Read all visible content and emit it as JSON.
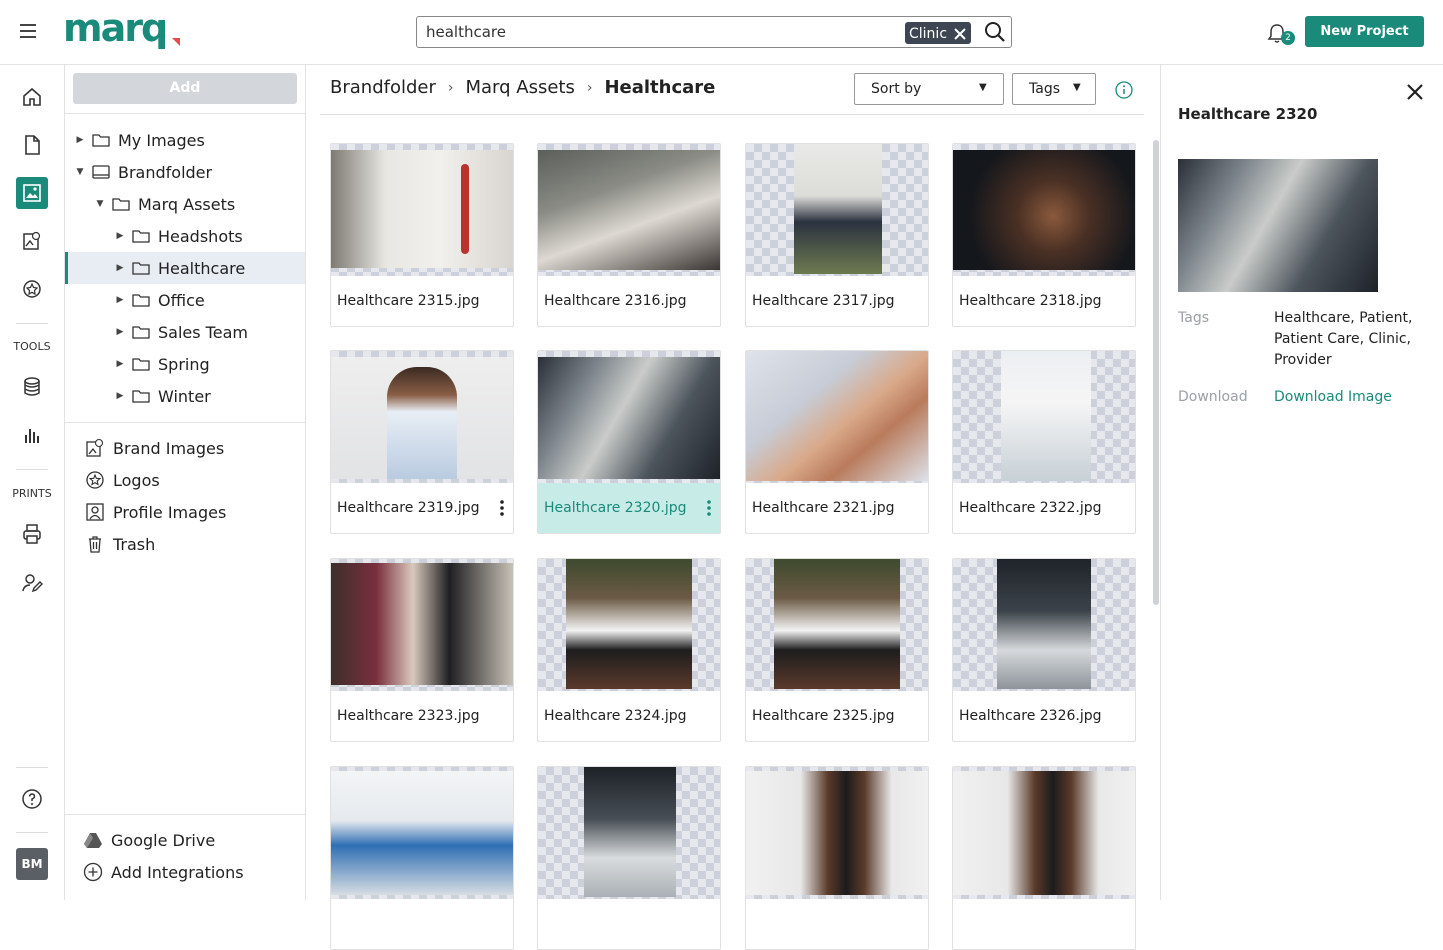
{
  "app": {
    "logo_text": "marq"
  },
  "search": {
    "query": "healthcare",
    "filter_chip": "Clinic"
  },
  "header": {
    "notification_count": "2",
    "new_project_label": "New Project"
  },
  "rail": {
    "tools_label": "TOOLS",
    "prints_label": "PRINTS",
    "avatar_initials": "BM"
  },
  "tree": {
    "add_label": "Add",
    "items": [
      {
        "label": "My Images"
      },
      {
        "label": "Brandfolder"
      },
      {
        "label": "Marq Assets"
      },
      {
        "label": "Headshots"
      },
      {
        "label": "Healthcare"
      },
      {
        "label": "Office"
      },
      {
        "label": "Sales Team"
      },
      {
        "label": "Spring"
      },
      {
        "label": "Winter"
      }
    ],
    "libraries": [
      {
        "label": "Brand Images"
      },
      {
        "label": "Logos"
      },
      {
        "label": "Profile Images"
      },
      {
        "label": "Trash"
      }
    ],
    "integrations": [
      {
        "label": "Google Drive"
      },
      {
        "label": "Add Integrations"
      }
    ]
  },
  "breadcrumb": [
    "Brandfolder",
    "Marq Assets",
    "Healthcare"
  ],
  "toolbar": {
    "sort_label": "Sort by",
    "tags_label": "Tags"
  },
  "grid": {
    "items": [
      {
        "name": "Healthcare 2315.jpg"
      },
      {
        "name": "Healthcare 2316.jpg"
      },
      {
        "name": "Healthcare 2317.jpg"
      },
      {
        "name": "Healthcare 2318.jpg"
      },
      {
        "name": "Healthcare 2319.jpg"
      },
      {
        "name": "Healthcare 2320.jpg"
      },
      {
        "name": "Healthcare 2321.jpg"
      },
      {
        "name": "Healthcare 2322.jpg"
      },
      {
        "name": "Healthcare 2323.jpg"
      },
      {
        "name": "Healthcare 2324.jpg"
      },
      {
        "name": "Healthcare 2325.jpg"
      },
      {
        "name": "Healthcare 2326.jpg"
      },
      {
        "name": ""
      },
      {
        "name": ""
      },
      {
        "name": ""
      },
      {
        "name": ""
      }
    ]
  },
  "detail": {
    "title": "Healthcare 2320",
    "tags_label": "Tags",
    "tags_value": "Healthcare, Patient, Patient Care, Clinic, Provider",
    "download_label": "Download",
    "download_link": "Download Image"
  },
  "colors": {
    "accent": "#1a8a7b",
    "selected_card": "#c7ece7",
    "tree_selected": "#e8edf4"
  }
}
